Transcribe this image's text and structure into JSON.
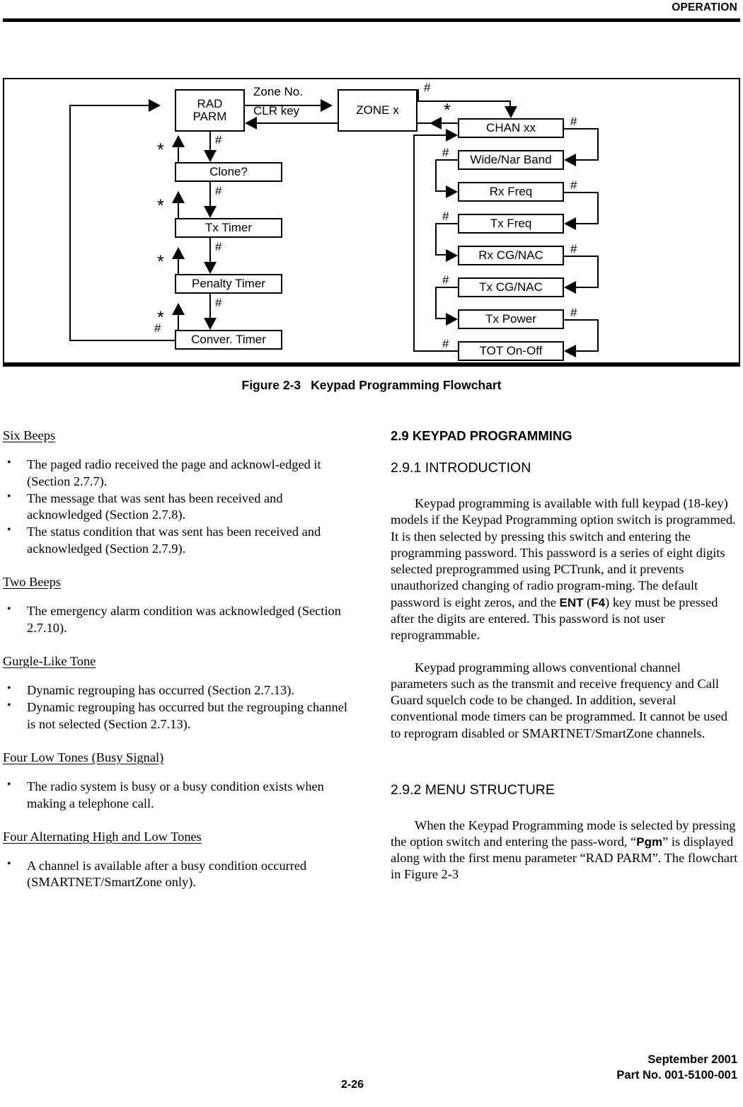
{
  "header": {
    "title": "OPERATION"
  },
  "figure": {
    "caption_number": "Figure 2-3",
    "caption_text": "Keypad Programming Flowchart",
    "boxes": {
      "rad_parm_line1": "RAD",
      "rad_parm_line2": "PARM",
      "clone": "Clone?",
      "tx_timer": "Tx Timer",
      "penalty_timer": "Penalty Timer",
      "conver_timer": "Conver. Timer",
      "zone_x": "ZONE x",
      "chan_xx": "CHAN xx",
      "wide_nar_band": "Wide/Nar Band",
      "rx_freq": "Rx Freq",
      "tx_freq": "Tx Freq",
      "rx_cg_nac": "Rx CG/NAC",
      "tx_cg_nac": "Tx CG/NAC",
      "tx_power": "Tx Power",
      "tot_on_off": "TOT On-Off"
    },
    "edge_labels": {
      "zone_no": "Zone No.",
      "clr_key": "CLR key",
      "hash": "#",
      "star": "*"
    }
  },
  "left_column": {
    "sections": [
      {
        "heading": "Six Beeps",
        "bullets": [
          "The paged radio received the page and acknowl-edged it (Section 2.7.7).",
          "The message that was sent has been received and acknowledged (Section 2.7.8).",
          "The status condition that was sent has been received and acknowledged (Section 2.7.9)."
        ]
      },
      {
        "heading": "Two Beeps",
        "bullets": [
          "The emergency alarm condition was acknowledged (Section 2.7.10)."
        ]
      },
      {
        "heading": "Gurgle-Like Tone",
        "bullets": [
          "Dynamic regrouping has occurred (Section 2.7.13).",
          "Dynamic regrouping has occurred but the regrouping channel is not selected (Section 2.7.13)."
        ]
      },
      {
        "heading": "Four Low Tones (Busy Signal)",
        "bullets": [
          "The radio system is busy or a busy condition exists when making a telephone call."
        ]
      },
      {
        "heading": "Four Alternating High and Low Tones",
        "bullets": [
          "A channel is available after a busy condition occurred (SMARTNET/SmartZone only)."
        ]
      }
    ]
  },
  "right_column": {
    "major_heading": "2.9 KEYPAD PROGRAMMING",
    "intro_heading": "2.9.1 INTRODUCTION",
    "intro_para_part1": "Keypad programming is available with full keypad (18-key) models if the Keypad Programming option switch is programmed. It is then selected by pressing this switch and entering the programming password. This password is a series of eight digits selected preprogrammed using PCTrunk, and it prevents unauthorized changing of radio program-ming. The default password is eight zeros, and the ",
    "intro_kbd_ent": "ENT",
    "intro_paren_open": " (",
    "intro_kbd_f4": "F4",
    "intro_para_part2": ") key must be pressed after the digits are entered. This password is not user reprogrammable.",
    "para2": "Keypad programming allows conventional channel parameters such as the transmit and receive frequency and Call Guard squelch code to be changed. In addition, several conventional mode timers can be programmed. It cannot be used to reprogram disabled or SMARTNET/SmartZone channels.",
    "menu_heading": "2.9.2 MENU STRUCTURE",
    "para3_part1": "When the Keypad Programming mode is selected by pressing the option switch and entering the pass-word, “",
    "para3_kbd_pgm": "Pgm",
    "para3_part2": "” is displayed along with the first menu parameter “RAD PARM”. The flowchart in Figure 2-3"
  },
  "footer": {
    "page_number": "2-26",
    "date": "September 2001",
    "part_number": "Part No. 001-5100-001"
  }
}
